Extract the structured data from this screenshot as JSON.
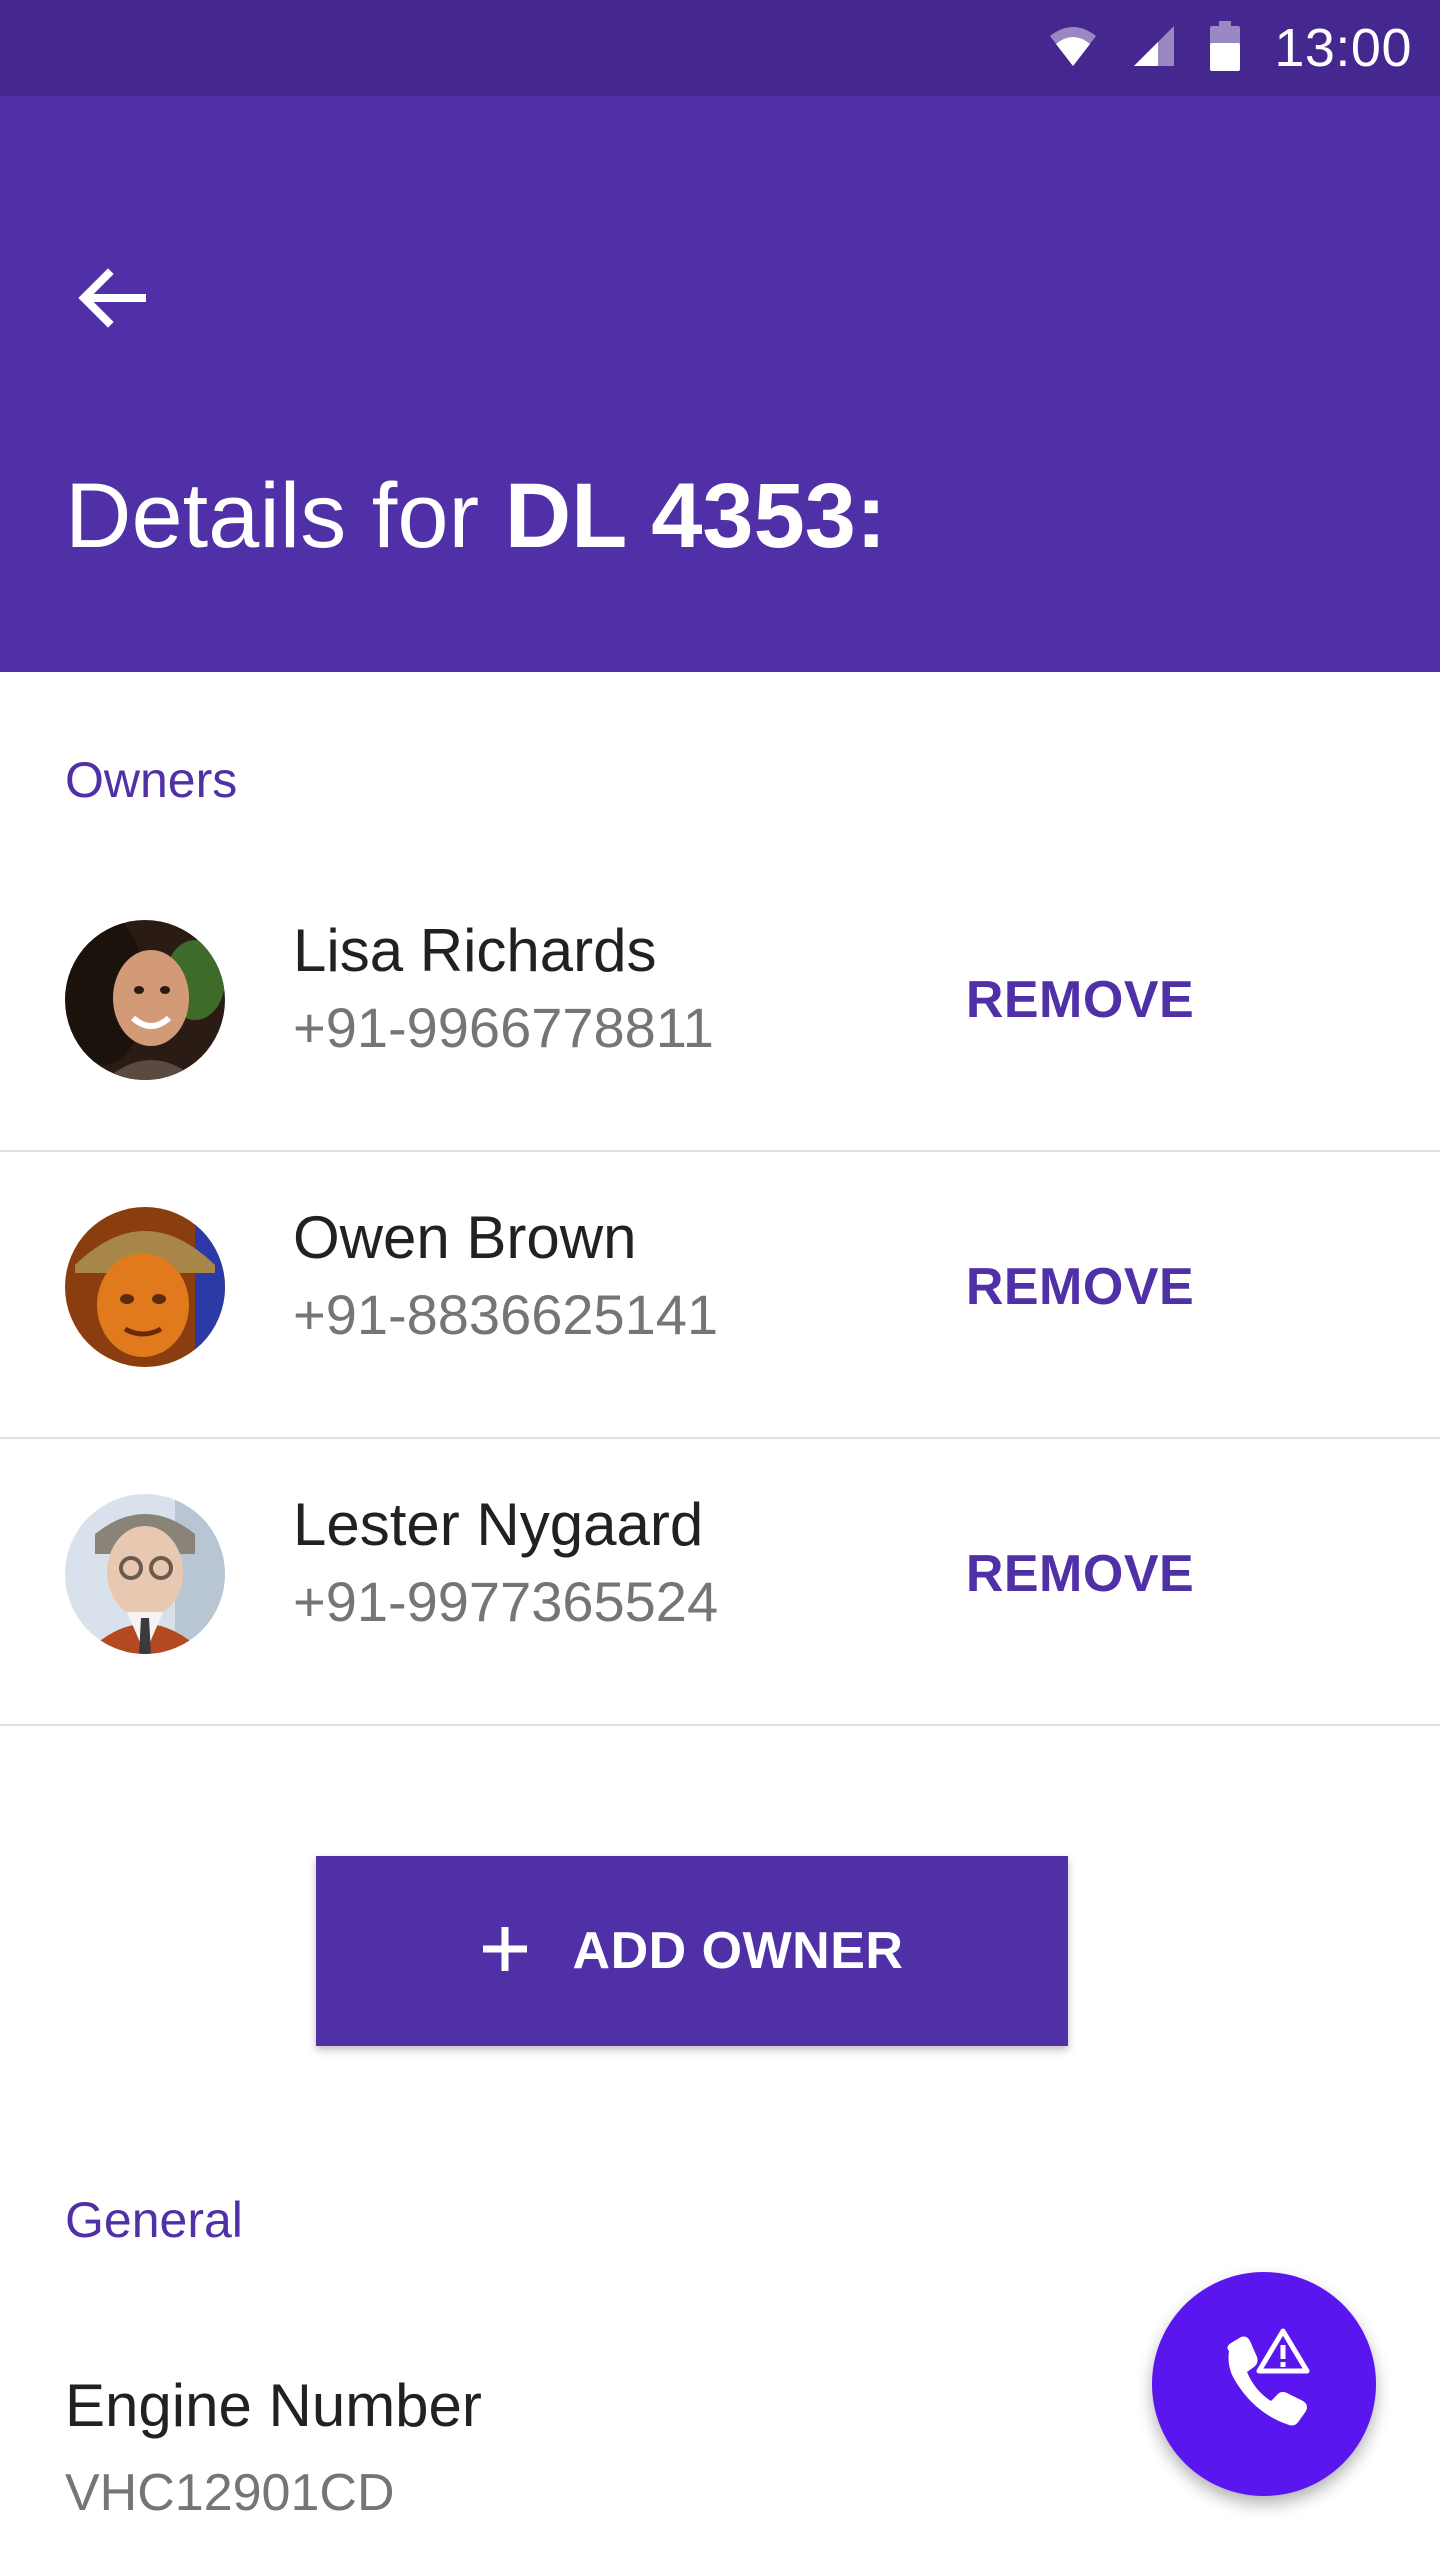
{
  "status_bar": {
    "time": "13:00",
    "icons": [
      "wifi-icon",
      "cell-signal-icon",
      "battery-icon"
    ]
  },
  "app_bar": {
    "back_icon": "arrow-back-icon",
    "title_prefix": "Details for ",
    "title_strong": "DL 4353:",
    "color": "#5030a6"
  },
  "owners": {
    "header": "Owners",
    "items": [
      {
        "name": "Lisa Richards",
        "phone": "+91-9966778811",
        "action": "REMOVE"
      },
      {
        "name": "Owen Brown",
        "phone": "+91-8836625141",
        "action": "REMOVE"
      },
      {
        "name": "Lester Nygaard",
        "phone": "+91-9977365524",
        "action": "REMOVE"
      }
    ],
    "add_button": {
      "icon": "plus-icon",
      "label": "ADD OWNER"
    }
  },
  "general": {
    "header": "General",
    "fields": [
      {
        "label": "Engine Number",
        "value": "VHC12901CD"
      }
    ]
  },
  "fab": {
    "icon": "phone-alert-icon",
    "color": "#5a16ef"
  },
  "colors": {
    "status_bar": "#452790",
    "primary": "#5030a6",
    "secondary_text": "#757575",
    "divider": "#e0e0e0"
  }
}
